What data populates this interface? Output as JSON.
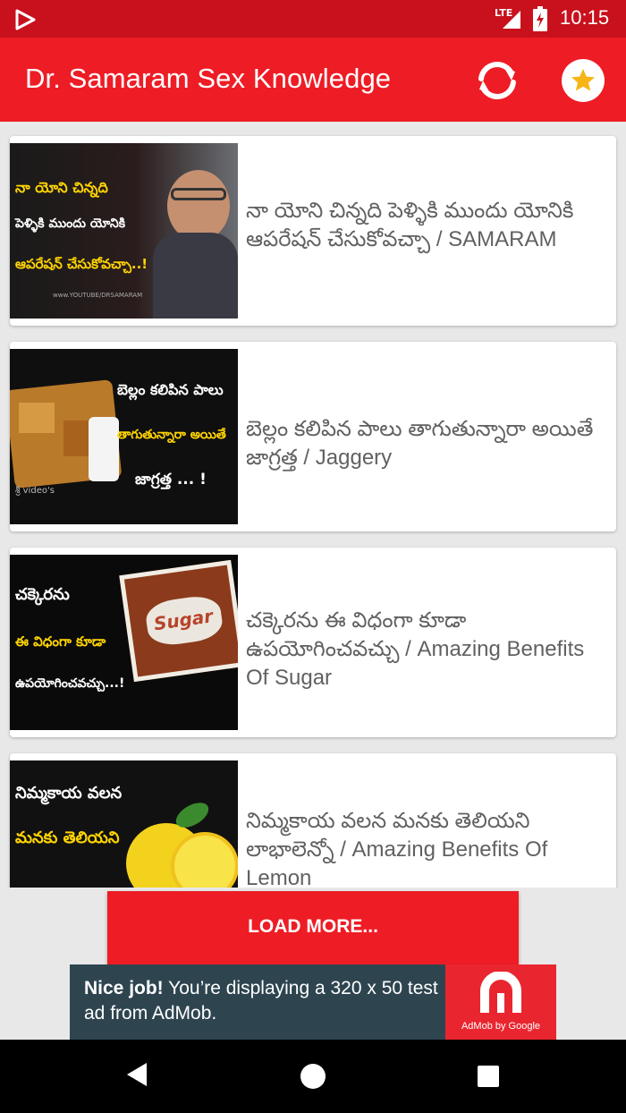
{
  "status_bar": {
    "network": "LTE",
    "time": "10:15",
    "icons": [
      "play-store-icon",
      "signal-icon",
      "battery-charging-icon"
    ]
  },
  "app_bar": {
    "title": "Dr. Samaram Sex Knowledge",
    "icons": [
      "refresh-icon",
      "star-icon"
    ],
    "color": "#ee1c25"
  },
  "videos": [
    {
      "title": "నా యోని చిన్నది పెళ్ళికి ముందు యోనికి ఆపరేషన్ చేసుకోవచ్చా / SAMARAM",
      "thumb_lines": [
        "నా యోని చిన్నది",
        "పెళ్ళికి ముందు యోనికి",
        "ఆపరేషన్ చేసుకోవచ్చా..!"
      ],
      "thumb_caption": "www.YOUTUBE/DRSAMARAM"
    },
    {
      "title": "బెల్లం కలిపిన పాలు తాగుతున్నారా అయితే జాగ్రత్త / Jaggery",
      "thumb_lines": [
        "బెల్లం కలిపిన పాలు",
        "తాగుతున్నారా అయితే",
        "జాగ్రత్త ... !"
      ],
      "thumb_caption": "శ్రీ video's"
    },
    {
      "title": "చక్కెరను ఈ విధంగా కూడా ఉపయోగించవచ్చు / Amazing Benefits Of Sugar",
      "thumb_lines": [
        "చక్కెరను",
        "ఈ విధంగా కూడా",
        "ఉపయోగించవచ్చు...!"
      ],
      "thumb_caption": "Sugar"
    },
    {
      "title": "నిమ్మకాయ వలన మనకు తెలియని లాభాలెన్నో / Amazing Benefits Of Lemon",
      "thumb_lines": [
        "నిమ్మకాయ వలన",
        "మనకు తెలియని"
      ],
      "thumb_caption": ""
    }
  ],
  "load_more": {
    "label": "LOAD MORE..."
  },
  "ad": {
    "headline": "Nice job!",
    "body": " You’re displaying a 320 x 50 test ad from AdMob.",
    "brand": "AdMob by Google"
  },
  "nav_bar": {
    "icons": [
      "back-icon",
      "home-icon",
      "recents-icon"
    ]
  }
}
